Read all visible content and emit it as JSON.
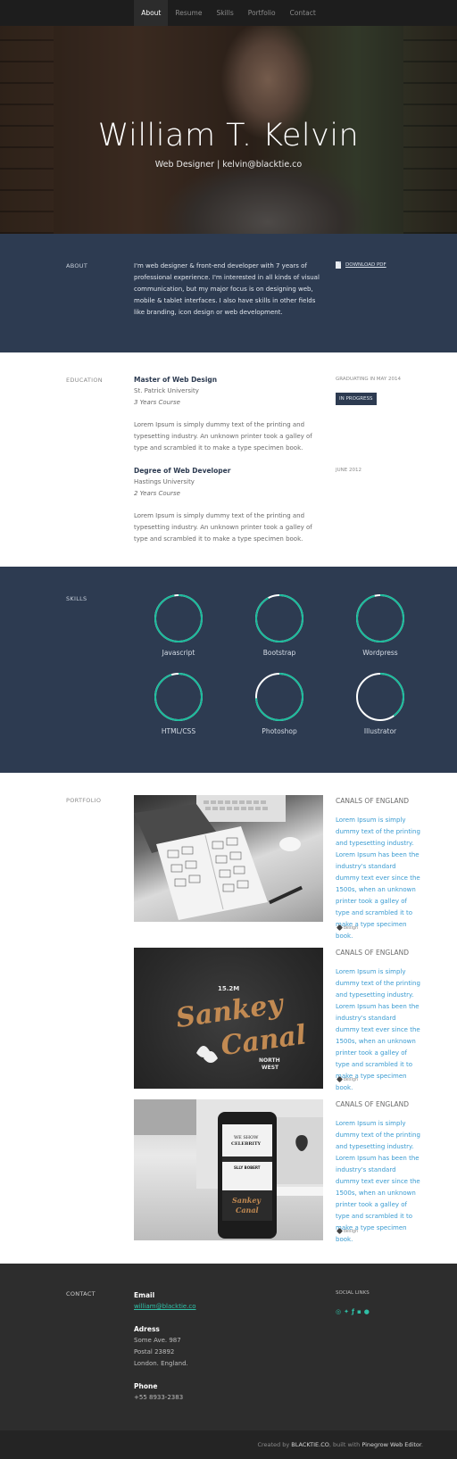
{
  "nav": {
    "items": [
      "About",
      "Resume",
      "Skills",
      "Portfolio",
      "Contact"
    ],
    "active": "About"
  },
  "hero": {
    "name": "William T. Kelvin",
    "subtitle": "Web Designer | kelvin@blacktie.co"
  },
  "about": {
    "label": "ABOUT",
    "text": "I'm web designer & front-end developer with 7 years of professional experience. I'm interested in all kinds of visual communication, but my major focus is on designing web, mobile & tablet interfaces. I also have skills in other fields like branding, icon design or web development.",
    "download": "DOWNLOAD PDF"
  },
  "education": {
    "label": "EDUCATION",
    "items": [
      {
        "degree": "Master of Web Design",
        "school": "St. Patrick University",
        "course": "3 Years Course",
        "desc": "Lorem Ipsum is simply dummy text of the printing and typesetting industry. An unknown printer took a galley of type and scrambled it to make a type specimen book.",
        "date": "GRADUATING IN MAY 2014",
        "badge": "IN PROGRESS"
      },
      {
        "degree": "Degree of Web Developer",
        "school": "Hastings University",
        "course": "2 Years Course",
        "desc": "Lorem Ipsum is simply dummy text of the printing and typesetting industry. An unknown printer took a galley of type and scrambled it to make a type specimen book.",
        "date": "JUNE 2012"
      }
    ]
  },
  "skills": {
    "label": "SKILLS",
    "items": [
      {
        "name": "Javascript",
        "percent": 0.97
      },
      {
        "name": "Bootstrap",
        "percent": 0.92
      },
      {
        "name": "Wordpress",
        "percent": 0.96
      },
      {
        "name": "HTML/CSS",
        "percent": 0.95
      },
      {
        "name": "Photoshop",
        "percent": 0.74
      },
      {
        "name": "Illustrator",
        "percent": 0.4
      }
    ],
    "accent": "#1abc9c"
  },
  "portfolio": {
    "label": "PORTFOLIO",
    "items": [
      {
        "title": "CANALS OF ENGLAND",
        "desc": "Lorem Ipsum is simply dummy text of the printing and typesetting industry. Lorem Ipsum has been the industry's standard dummy text ever since the 1500s, when an unknown printer took a galley of type and scrambled it to make a type specimen book.",
        "tag": "design"
      },
      {
        "title": "CANALS OF ENGLAND",
        "desc": "Lorem Ipsum is simply dummy text of the printing and typesetting industry. Lorem Ipsum has been the industry's standard dummy text ever since the 1500s, when an unknown printer took a galley of type and scrambled it to make a type specimen book.",
        "tag": "design",
        "art": {
          "line1": "15.2M",
          "line2": "Sankey",
          "line3": "Canal",
          "line4": "NORTH",
          "line5": "WEST"
        }
      },
      {
        "title": "CANALS OF ENGLAND",
        "desc": "Lorem Ipsum is simply dummy text of the printing and typesetting industry. Lorem Ipsum has been the industry's standard dummy text ever since the 1500s, when an unknown printer took a galley of type and scrambled it to make a type specimen book.",
        "tag": "design",
        "art": {
          "line1": "WE SHOW",
          "line2": "CELEBRITY",
          "line3": "SLLY BOBERT",
          "line4": "Sankey",
          "line5": "Canal"
        }
      }
    ]
  },
  "contact": {
    "label": "CONTACT",
    "email_label": "Email",
    "email": "william@blacktie.co",
    "address_label": "Adress",
    "address": [
      "Some Ave. 987",
      "Postal 23892",
      "London. England."
    ],
    "phone_label": "Phone",
    "phone": "+55 8933-2383",
    "social_label": "SOCIAL LINKS",
    "social_icons": [
      "dribbble-icon",
      "twitter-icon",
      "facebook-icon",
      "linkedin-icon",
      "apple-icon"
    ]
  },
  "footer": {
    "prefix": "Created by ",
    "brand": "BLACKTIE.CO",
    "middle": ", built with ",
    "tool": "Pinegrow Web Editor",
    "suffix": "."
  }
}
